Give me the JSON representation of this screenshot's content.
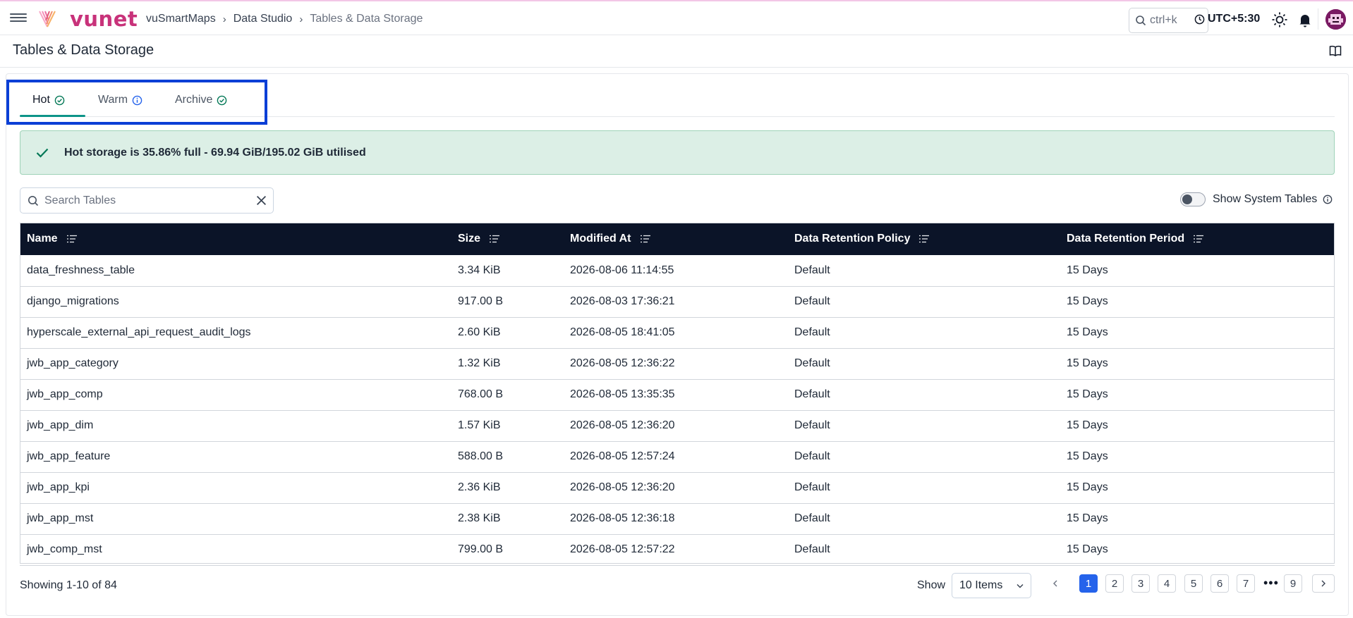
{
  "app": {
    "brand": "vunet",
    "brand_color": "#c8327a"
  },
  "breadcrumb": {
    "items": [
      "vuSmartMaps",
      "Data Studio",
      "Tables & Data Storage"
    ],
    "separator": "›"
  },
  "topbar": {
    "search_hint": "ctrl+k",
    "timezone": "UTC+5:30",
    "icons": [
      "menu-icon",
      "search-icon",
      "clock-icon",
      "sun-icon",
      "bell-icon",
      "avatar"
    ]
  },
  "page": {
    "title": "Tables & Data Storage"
  },
  "tabs": [
    {
      "label": "Hot",
      "icon": "check-circle-icon",
      "active": true
    },
    {
      "label": "Warm",
      "icon": "info-circle-icon",
      "active": false
    },
    {
      "label": "Archive",
      "icon": "check-circle-icon",
      "active": false
    }
  ],
  "alert": {
    "text": "Hot storage is 35.86% full - 69.94 GiB/195.02 GiB utilised",
    "status_color": "#047857"
  },
  "search": {
    "placeholder": "Search Tables",
    "value": ""
  },
  "system_tables": {
    "label": "Show System Tables",
    "enabled": false
  },
  "table": {
    "columns": [
      "Name",
      "Size",
      "Modified At",
      "Data Retention Policy",
      "Data Retention Period"
    ],
    "rows": [
      [
        "data_freshness_table",
        "3.34 KiB",
        "2026-08-06 11:14:55",
        "Default",
        "15 Days"
      ],
      [
        "django_migrations",
        "917.00 B",
        "2026-08-03 17:36:21",
        "Default",
        "15 Days"
      ],
      [
        "hyperscale_external_api_request_audit_logs",
        "2.60 KiB",
        "2026-08-05 18:41:05",
        "Default",
        "15 Days"
      ],
      [
        "jwb_app_category",
        "1.32 KiB",
        "2026-08-05 12:36:22",
        "Default",
        "15 Days"
      ],
      [
        "jwb_app_comp",
        "768.00 B",
        "2026-08-05 13:35:35",
        "Default",
        "15 Days"
      ],
      [
        "jwb_app_dim",
        "1.57 KiB",
        "2026-08-05 12:36:20",
        "Default",
        "15 Days"
      ],
      [
        "jwb_app_feature",
        "588.00 B",
        "2026-08-05 12:57:24",
        "Default",
        "15 Days"
      ],
      [
        "jwb_app_kpi",
        "2.36 KiB",
        "2026-08-05 12:36:20",
        "Default",
        "15 Days"
      ],
      [
        "jwb_app_mst",
        "2.38 KiB",
        "2026-08-05 12:36:18",
        "Default",
        "15 Days"
      ],
      [
        "jwb_comp_mst",
        "799.00 B",
        "2026-08-05 12:57:22",
        "Default",
        "15 Days"
      ]
    ]
  },
  "footer": {
    "showing": "Showing 1-10 of 84",
    "show_label": "Show",
    "page_size": "10 Items",
    "pages": [
      "1",
      "2",
      "3",
      "4",
      "5",
      "6",
      "7"
    ],
    "ellipsis": "•••",
    "last_page": "9",
    "current_page": "1",
    "accent_color": "#2563eb"
  }
}
